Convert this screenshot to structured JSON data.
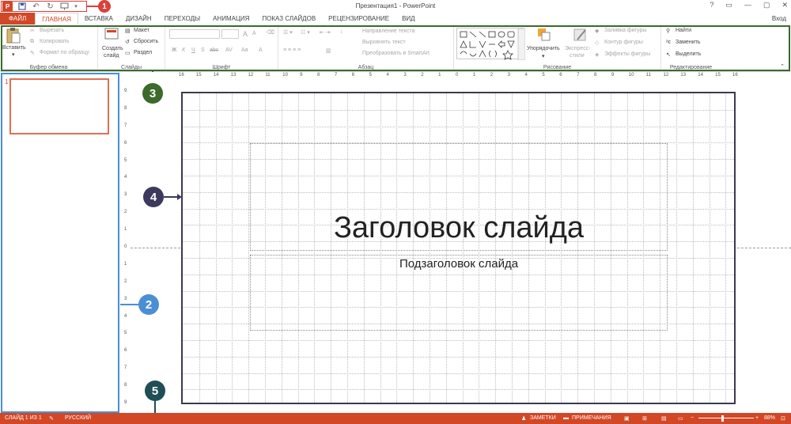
{
  "window": {
    "title": "Презентация1 - PowerPoint",
    "controls": [
      "?",
      "▭",
      "—",
      "▢",
      "✕"
    ]
  },
  "qat": {
    "logo": "P",
    "items": [
      "save-icon",
      "undo-icon",
      "redo-icon",
      "present-icon"
    ]
  },
  "tabs": {
    "file": "ФАЙЛ",
    "home": "ГЛАВНАЯ",
    "insert": "ВСТАВКА",
    "design": "ДИЗАЙН",
    "transitions": "ПЕРЕХОДЫ",
    "animation": "АНИМАЦИЯ",
    "slideshow": "ПОКАЗ СЛАЙДОВ",
    "review": "РЕЦЕНЗИРОВАНИЕ",
    "view": "ВИД",
    "signin": "Вход"
  },
  "ribbon": {
    "clipboard": {
      "label": "Буфер обмена",
      "paste": "Вставить",
      "cut": "Вырезать",
      "copy": "Копировать",
      "format": "Формат по образцу"
    },
    "slides": {
      "label": "Слайды",
      "new_slide": "Создать",
      "new_slide2": "слайд",
      "layout": "Макет",
      "reset": "Сбросить",
      "section": "Раздел"
    },
    "font": {
      "label": "Шрифт",
      "bold": "Ж",
      "italic": "К",
      "underline": "Ч",
      "strike": "S",
      "abc": "abc",
      "av": "AV",
      "aa": "Aa",
      "grow": "A",
      "shrink": "A"
    },
    "paragraph": {
      "label": "Абзац",
      "text_dir": "Направление текста",
      "align_text": "Выровнять текст",
      "smartart": "Преобразовать в SmartArt"
    },
    "drawing": {
      "label": "Рисование",
      "arrange": "Упорядочить",
      "styles1": "Экспресс-",
      "styles2": "стили",
      "fill": "Заливка фигуры",
      "outline": "Контур фигуры",
      "effects": "Эффекты фигуры"
    },
    "editing": {
      "label": "Редактирование",
      "find": "Найти",
      "replace": "Заменить",
      "select": "Выделить"
    }
  },
  "thumbnail": {
    "number": "1"
  },
  "slide": {
    "title": "Заголовок слайда",
    "subtitle": "Подзаголовок слайда"
  },
  "hruler": [
    "16",
    "15",
    "14",
    "13",
    "12",
    "11",
    "10",
    "9",
    "8",
    "7",
    "6",
    "5",
    "4",
    "3",
    "2",
    "1",
    "0",
    "1",
    "2",
    "3",
    "4",
    "5",
    "6",
    "7",
    "8",
    "9",
    "10",
    "11",
    "12",
    "13",
    "14",
    "15",
    "16"
  ],
  "vruler": [
    "9",
    "8",
    "7",
    "6",
    "5",
    "4",
    "3",
    "2",
    "1",
    "0",
    "1",
    "2",
    "3",
    "4",
    "5",
    "6",
    "7",
    "8",
    "9"
  ],
  "status": {
    "slide": "СЛАЙД 1 ИЗ 1",
    "lang": "РУССКИЙ",
    "notes": "ЗАМЕТКИ",
    "comments": "ПРИМЕЧАНИЯ",
    "zoom": "88%"
  },
  "callouts": [
    "1",
    "2",
    "3",
    "4",
    "5"
  ],
  "colors": {
    "accent": "#d24726",
    "callout_red": "#d9413b",
    "callout_blue": "#4a8fd4",
    "callout_green": "#3c6a2a",
    "callout_navy": "#3b3a5e",
    "callout_teal": "#1f4e56",
    "ribbon_outline": "#3c6a2a",
    "slide_outline": "#3a3a50"
  }
}
